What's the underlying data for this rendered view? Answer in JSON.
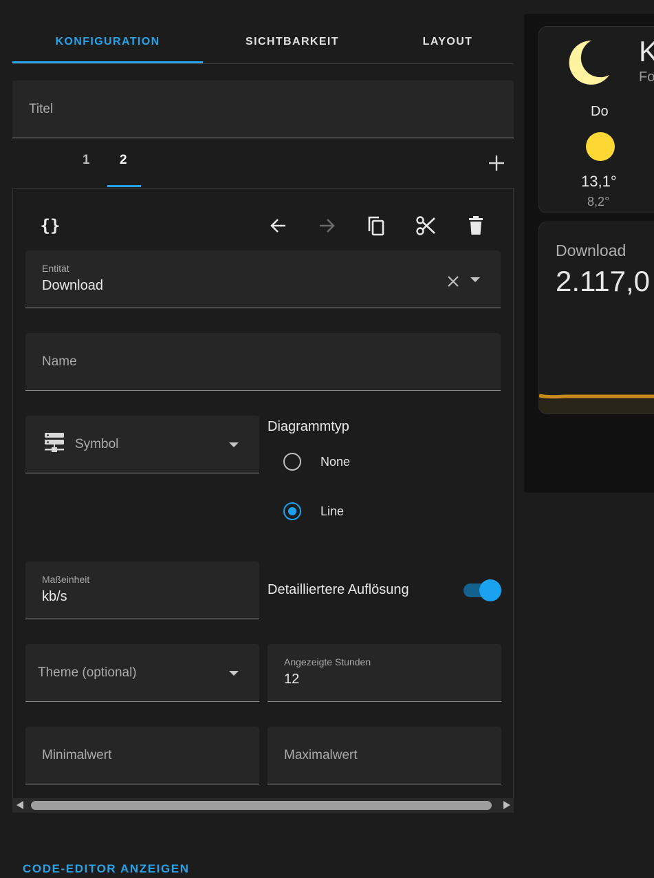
{
  "tabs": [
    {
      "label": "KONFIGURATION",
      "active": true
    },
    {
      "label": "SICHTBARKEIT",
      "active": false
    },
    {
      "label": "LAYOUT",
      "active": false
    }
  ],
  "title_field": {
    "placeholder": "Titel"
  },
  "sub_tabs": [
    {
      "label": "1",
      "active": false
    },
    {
      "label": "2",
      "active": true
    }
  ],
  "toolbar": {
    "code_icon": "curly-braces-icon",
    "move_left_icon": "arrow-left-icon",
    "move_right_icon": "arrow-right-icon",
    "copy_icon": "copy-icon",
    "cut_icon": "scissors-icon",
    "delete_icon": "trash-icon"
  },
  "entity_field": {
    "label": "Entität",
    "value": "Download"
  },
  "name_field": {
    "placeholder": "Name"
  },
  "symbol_field": {
    "placeholder": "Symbol",
    "icon": "server-network-icon"
  },
  "chart_type": {
    "label": "Diagrammtyp",
    "options": [
      {
        "label": "None",
        "checked": false
      },
      {
        "label": "Line",
        "checked": true
      }
    ]
  },
  "unit_field": {
    "label": "Maßeinheit",
    "value": "kb/s"
  },
  "detail_toggle": {
    "label": "Detailliertere Auflösung",
    "on": true
  },
  "theme_field": {
    "placeholder": "Theme (optional)"
  },
  "hours_field": {
    "label": "Angezeigte Stunden",
    "value": "12"
  },
  "min_field": {
    "placeholder": "Minimalwert"
  },
  "max_field": {
    "placeholder": "Maximalwert"
  },
  "code_editor_label": "CODE-EDITOR ANZEIGEN",
  "preview": {
    "weather": {
      "title_partial": "K",
      "subtitle_partial": "Fo",
      "day": "Do",
      "high": "13,1°",
      "low": "8,2°"
    },
    "sensor": {
      "name": "Download",
      "value_partial": "2.117,0"
    }
  },
  "colors": {
    "accent": "#28a3e8",
    "background": "#1c1c1c",
    "moon": "#fff3a0",
    "sun": "#fdd835",
    "graph_line": "#c88a1c"
  }
}
